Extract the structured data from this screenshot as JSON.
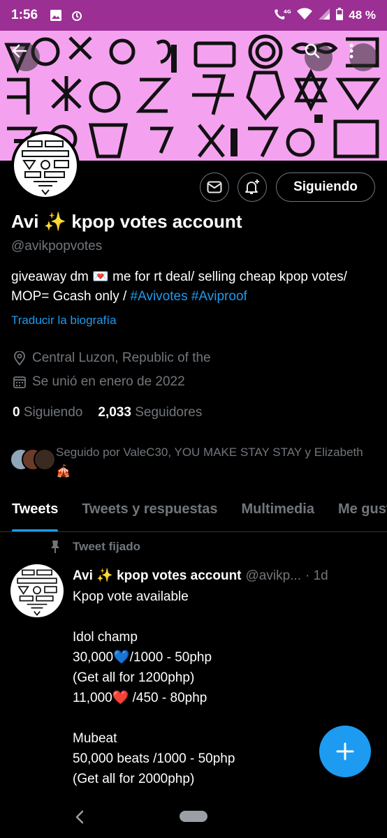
{
  "statusbar": {
    "time": "1:56",
    "battery": "48 %",
    "network": "4G"
  },
  "profile": {
    "name": "Avi ✨ kpop votes account",
    "handle": "@avikpopvotes",
    "bio_prefix": "giveaway dm 💌 me for rt deal/ selling cheap kpop votes/ MOP= Gcash only / ",
    "bio_tag1": "#Avivotes",
    "bio_tag2": "#Aviproof",
    "translate_label": "Traducir la biografía",
    "location": "Central Luzon, Republic of the",
    "joined": "Se unió en enero de 2022",
    "following_count": "0",
    "following_label": "Siguiendo",
    "followers_count": "2,033",
    "followers_label": "Seguidores",
    "followed_by": "Seguido por ValeC30, YOU MAKE STAY STAY y Elizabeth 🎪"
  },
  "actions": {
    "follow_label": "Siguiendo"
  },
  "tabs": [
    {
      "label": "Tweets",
      "active": true
    },
    {
      "label": "Tweets y respuestas",
      "active": false
    },
    {
      "label": "Multimedia",
      "active": false
    },
    {
      "label": "Me gusta",
      "active": false
    }
  ],
  "pinned_label": "Tweet fijado",
  "tweet": {
    "author": "Avi ✨ kpop votes account",
    "handle": "@avikp...",
    "time": "· 1d",
    "body": "Kpop vote available\n\nIdol champ\n30,000💙/1000 - 50php\n(Get all for 1200php)\n11,000❤️ /450 - 80php\n\nMubeat\n50,000 beats /1000 - 50php\n(Get all for 2000php)"
  },
  "colors": {
    "accent": "#1d9bf0",
    "statusbar": "#9b2f94",
    "banner": "#f4a2ef",
    "muted_text": "#71767b"
  },
  "icons": [
    "back-arrow-icon",
    "search-icon",
    "more-icon",
    "mail-icon",
    "bell-plus-icon",
    "location-icon",
    "calendar-icon",
    "pin-icon",
    "plus-icon"
  ]
}
